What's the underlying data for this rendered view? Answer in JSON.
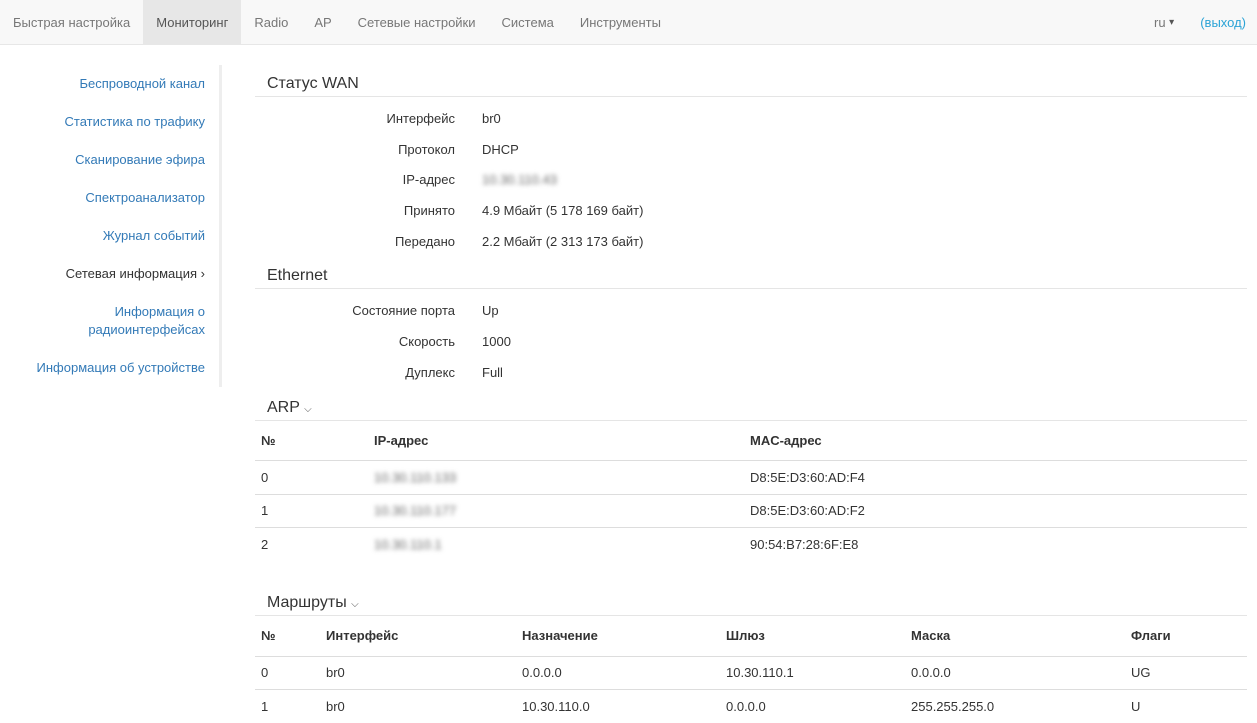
{
  "nav": {
    "items": [
      "Быстрая настройка",
      "Мониторинг",
      "Radio",
      "AP",
      "Сетевые настройки",
      "Система",
      "Инструменты"
    ],
    "lang": "ru",
    "logout": "(выход)"
  },
  "sidebar": [
    "Беспроводной канал",
    "Статистика по трафику",
    "Сканирование эфира",
    "Спектроанализатор",
    "Журнал событий",
    "Сетевая информация",
    "Информация о радиоинтерфейсах",
    "Информация об устройстве"
  ],
  "wan": {
    "title": "Статус WAN",
    "rows": [
      [
        "Интерфейс",
        "br0"
      ],
      [
        "Протокол",
        "DHCP"
      ],
      [
        "IP-адрес",
        "10.30.110.43"
      ],
      [
        "Принято",
        "4.9 Мбайт (5 178 169 байт)"
      ],
      [
        "Передано",
        "2.2 Мбайт (2 313 173 байт)"
      ]
    ]
  },
  "eth": {
    "title": "Ethernet",
    "rows": [
      [
        "Состояние порта",
        "Up"
      ],
      [
        "Скорость",
        "1000"
      ],
      [
        "Дуплекс",
        "Full"
      ]
    ]
  },
  "arp": {
    "title": "ARP",
    "headers": [
      "№",
      "IP-адрес",
      "MAC-адрес"
    ],
    "rows": [
      [
        "0",
        "10.30.110.133",
        "D8:5E:D3:60:AD:F4"
      ],
      [
        "1",
        "10.30.110.177",
        "D8:5E:D3:60:AD:F2"
      ],
      [
        "2",
        "10.30.110.1",
        "90:54:B7:28:6F:E8"
      ]
    ]
  },
  "routes": {
    "title": "Маршруты",
    "headers": [
      "№",
      "Интерфейс",
      "Назначение",
      "Шлюз",
      "Маска",
      "Флаги"
    ],
    "rows": [
      [
        "0",
        "br0",
        "0.0.0.0",
        "10.30.110.1",
        "0.0.0.0",
        "UG"
      ],
      [
        "1",
        "br0",
        "10.30.110.0",
        "0.0.0.0",
        "255.255.255.0",
        "U"
      ]
    ]
  }
}
